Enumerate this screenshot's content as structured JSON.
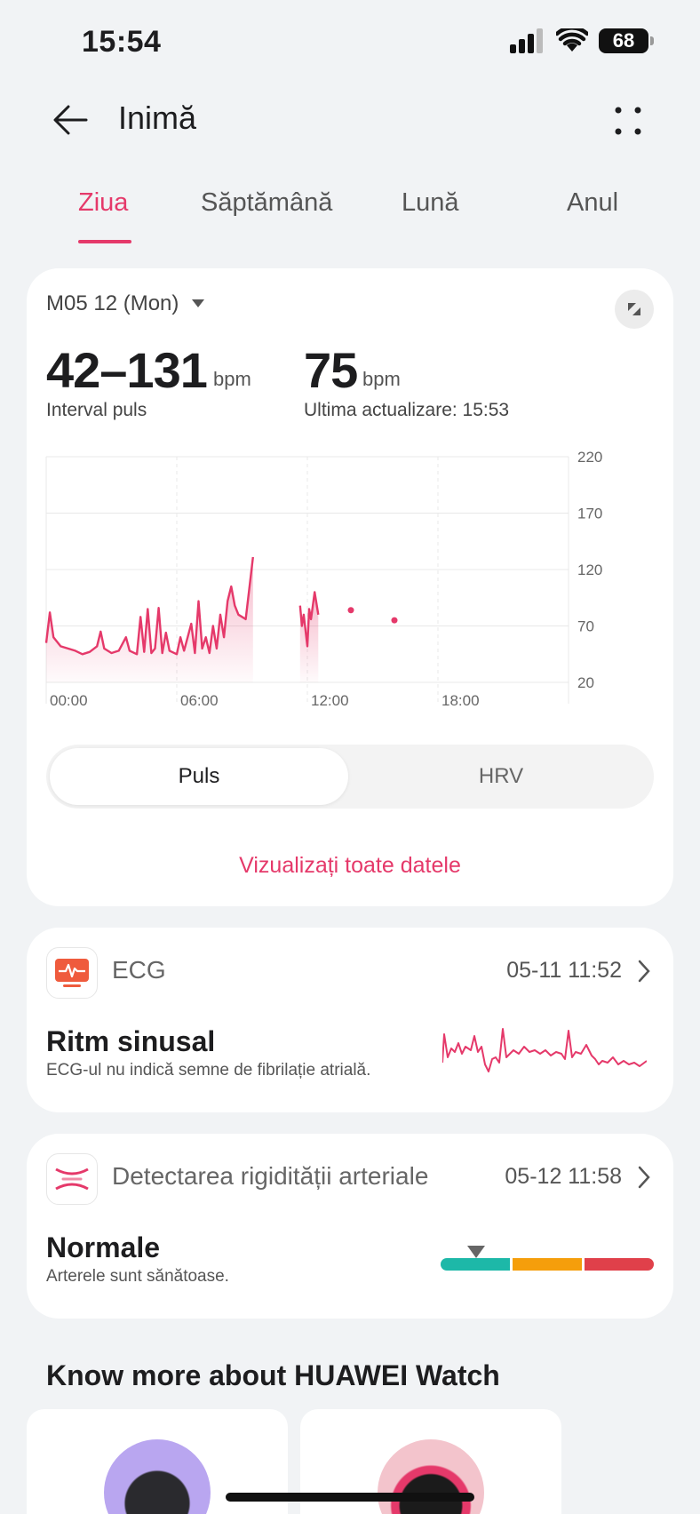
{
  "status_bar": {
    "time": "15:54",
    "battery": "68"
  },
  "header": {
    "title": "Inimă",
    "back_icon": "arrow-left-icon",
    "more_icon": "more-dots-icon"
  },
  "tabs": [
    {
      "label": "Ziua",
      "active": true
    },
    {
      "label": "Săptămână",
      "active": false
    },
    {
      "label": "Lună",
      "active": false
    },
    {
      "label": "Anul",
      "active": false
    }
  ],
  "heart_card": {
    "date": "M05 12 (Mon)",
    "range_value": "42–131",
    "range_unit": "bpm",
    "range_label": "Interval puls",
    "latest_value": "75",
    "latest_unit": "bpm",
    "latest_label": "Ultima actualizare: 15:53",
    "view_all": "Vizualizați toate datele",
    "segment": {
      "selected": "Puls",
      "other": "HRV"
    }
  },
  "chart_data": {
    "type": "line",
    "title": "",
    "xlabel": "",
    "ylabel": "",
    "ylim": [
      20,
      220
    ],
    "xlim": [
      "00:00",
      "24:00"
    ],
    "y_ticks": [
      "220",
      "170",
      "120",
      "70",
      "20"
    ],
    "x_ticks": [
      "00:00",
      "06:00",
      "12:00",
      "18:00"
    ],
    "grid": true,
    "color": "#e5396a",
    "series": [
      {
        "segments": [
          [
            [
              "00:00",
              55
            ],
            [
              "00:10",
              82
            ],
            [
              "00:20",
              60
            ],
            [
              "00:40",
              52
            ],
            [
              "01:00",
              50
            ],
            [
              "01:20",
              48
            ],
            [
              "01:40",
              45
            ],
            [
              "02:00",
              47
            ],
            [
              "02:20",
              52
            ],
            [
              "02:30",
              65
            ],
            [
              "02:40",
              50
            ],
            [
              "03:00",
              46
            ],
            [
              "03:20",
              48
            ],
            [
              "03:40",
              60
            ],
            [
              "03:50",
              48
            ],
            [
              "04:10",
              45
            ],
            [
              "04:20",
              78
            ],
            [
              "04:30",
              47
            ],
            [
              "04:40",
              85
            ],
            [
              "04:50",
              46
            ],
            [
              "05:00",
              50
            ],
            [
              "05:10",
              86
            ],
            [
              "05:20",
              46
            ],
            [
              "05:30",
              64
            ],
            [
              "05:40",
              48
            ],
            [
              "06:00",
              45
            ],
            [
              "06:10",
              60
            ],
            [
              "06:20",
              48
            ],
            [
              "06:40",
              72
            ],
            [
              "06:50",
              46
            ],
            [
              "07:00",
              92
            ],
            [
              "07:10",
              50
            ],
            [
              "07:20",
              60
            ],
            [
              "07:30",
              46
            ],
            [
              "07:40",
              70
            ],
            [
              "07:50",
              50
            ],
            [
              "08:00",
              80
            ],
            [
              "08:10",
              60
            ],
            [
              "08:20",
              92
            ],
            [
              "08:30",
              105
            ],
            [
              "08:40",
              88
            ],
            [
              "08:50",
              80
            ],
            [
              "09:00",
              78
            ],
            [
              "09:10",
              76
            ]
          ],
          [
            [
              "11:40",
              88
            ],
            [
              "11:45",
              70
            ],
            [
              "11:50",
              80
            ],
            [
              "12:00",
              52
            ],
            [
              "12:05",
              85
            ],
            [
              "12:10",
              76
            ],
            [
              "12:20",
              100
            ],
            [
              "12:30",
              80
            ]
          ]
        ],
        "points": [
          [
            "14:00",
            84
          ],
          [
            "16:00",
            75
          ]
        ],
        "peak": [
          "09:30",
          131
        ]
      }
    ]
  },
  "ecg_card": {
    "icon": "ecg-icon",
    "label": "ECG",
    "time": "05-11 11:52",
    "result": "Ritm sinusal",
    "detail": "ECG-ul nu indică semne de fibrilație atrială."
  },
  "arterial_card": {
    "icon": "arterial-stiffness-icon",
    "label": "Detectarea rigidității arteriale",
    "time": "05-12 11:58",
    "result": "Normale",
    "detail": "Arterele sunt sănătoase.",
    "scale_colors": [
      "#1db8a8",
      "#f59e0b",
      "#e0404a"
    ],
    "level": "normal"
  },
  "promo": {
    "title": "Know more about HUAWEI Watch"
  }
}
